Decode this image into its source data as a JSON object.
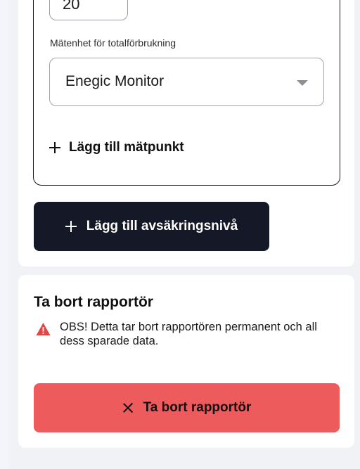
{
  "form": {
    "number_value": "20",
    "unit_label": "Mätenhet för totalförbrukning",
    "unit_selected": "Enegic Monitor",
    "add_point_label": "Lägg till mätpunkt",
    "add_level_label": "Lägg till avsäkringsnivå"
  },
  "remove": {
    "title": "Ta bort rapportör",
    "warning": "OBS! Detta tar bort rapportören permanent och all dess sparade data.",
    "button_label": "Ta bort rapportör"
  },
  "icons": {
    "add": "plus-icon",
    "dropdown": "chevron-down-icon",
    "warning": "warning-triangle-icon",
    "close": "close-icon"
  },
  "colors": {
    "dark_button": "#151826",
    "danger_button": "#ee5b5d",
    "warning_icon": "#e04848"
  }
}
